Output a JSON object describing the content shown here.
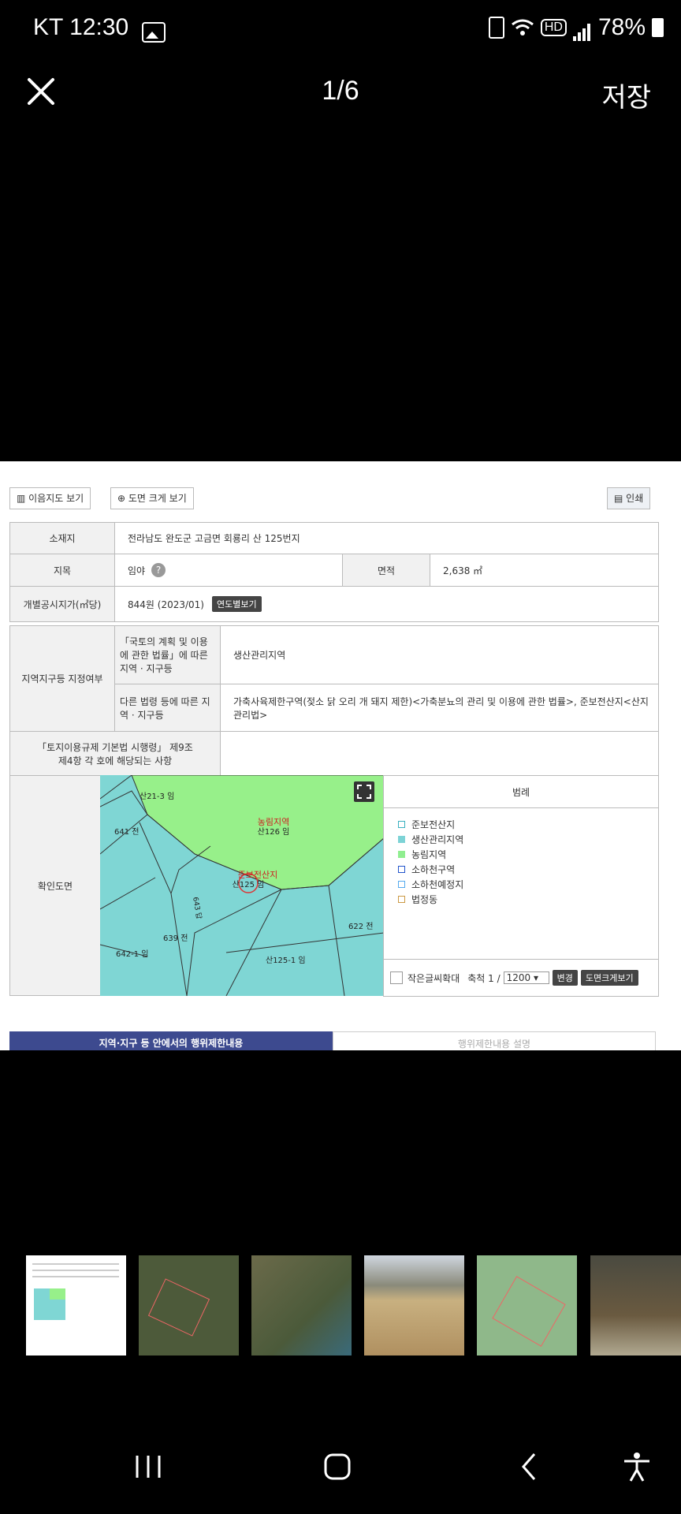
{
  "status_bar": {
    "carrier_time": "KT 12:30",
    "battery": "78%",
    "hd": "HD"
  },
  "top_bar": {
    "counter": "1/6",
    "save_label": "저장"
  },
  "toolbar": {
    "map_view": "이음지도 보기",
    "enlarge_view": "도면 크게 보기",
    "print": "인쇄"
  },
  "land": {
    "location_label": "소재지",
    "location_value": "전라남도 완도군 고금면 회룡리 산 125번지",
    "category_label": "지목",
    "category_value": "임야",
    "area_label": "면적",
    "area_value": "2,638 ㎡",
    "price_label": "개별공시지가(㎡당)",
    "price_value": "844원 (2023/01)",
    "price_button": "연도별보기",
    "zone_label": "지역지구등 지정여부",
    "zone_row1_label": "「국토의 계획 및 이용에 관한 법률」에 따른 지역 · 지구등",
    "zone_row1_value": "생산관리지역",
    "zone_row2_label": "다른 법령 등에 따른 지역 · 지구등",
    "zone_row2_value": "가축사육제한구역(젖소 닭 오리 개 돼지 제한)<가축분뇨의 관리 및 이용에 관한 법률>, 준보전산지<산지관리법>",
    "act_label": "「토지이용규제 기본법 시행령」 제9조 제4항 각 호에 해당되는 사항",
    "map_label": "확인도면"
  },
  "map": {
    "labels": [
      "농림지역",
      "산126 임",
      "준보전산지",
      "산125 임",
      "641 전",
      "639 전",
      "642-1 임",
      "622 전",
      "산125-1 임",
      "산21-3 임",
      "643 답"
    ]
  },
  "legend": {
    "title": "범례",
    "items": [
      {
        "label": "준보전산지",
        "color": "#ffffff",
        "border": "#3ab0c0"
      },
      {
        "label": "생산관리지역",
        "color": "#7dd3d6",
        "border": "#7dd3d6"
      },
      {
        "label": "농림지역",
        "color": "#90ee90",
        "border": "#90ee90"
      },
      {
        "label": "소하천구역",
        "color": "#ffffff",
        "border": "#2255cc"
      },
      {
        "label": "소하천예정지",
        "color": "#ffffff",
        "border": "#55aaee"
      },
      {
        "label": "법정동",
        "color": "#ffffff",
        "border": "#cc9944"
      }
    ],
    "small_text": "작은글씨확대",
    "scale_prefix": "축척 1 /",
    "scale_value": "1200",
    "change": "변경",
    "big_view": "도면크게보기"
  },
  "tabs": {
    "left": "지역·지구 등 안에서의 행위제한내용",
    "right": "행위제한내용 설명"
  }
}
